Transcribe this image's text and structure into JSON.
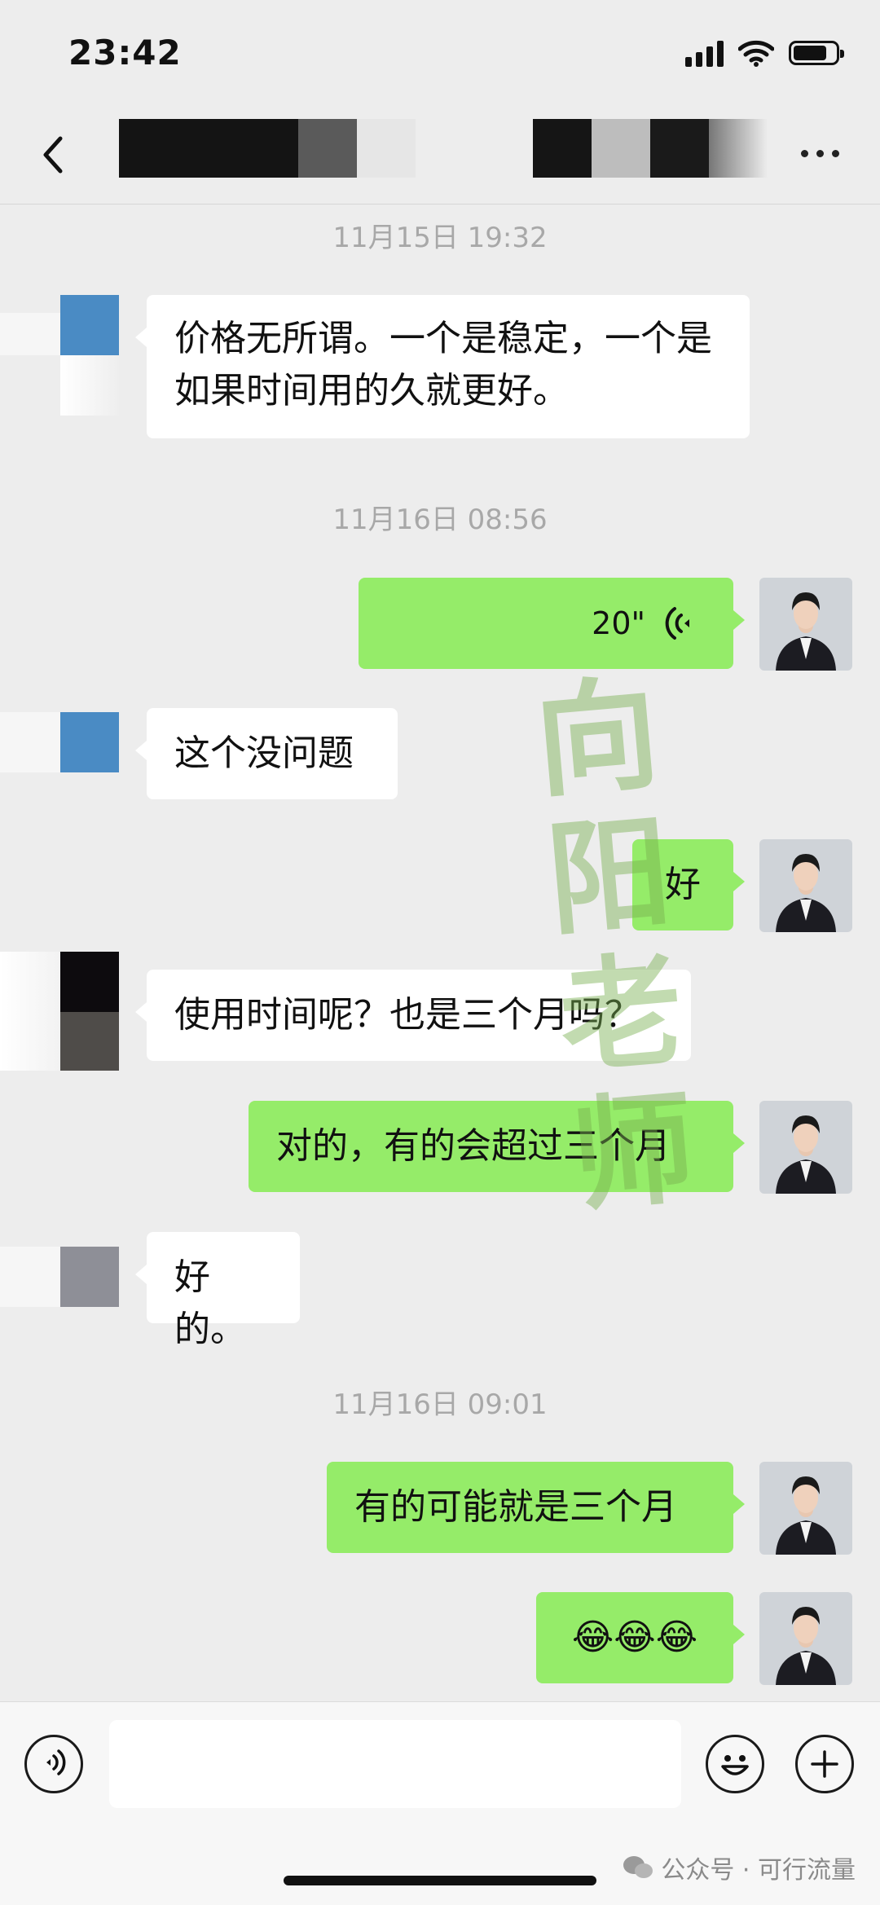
{
  "status_bar": {
    "time": "23:42",
    "battery_level": 0.8,
    "signal_bars": 4
  },
  "nav": {
    "back_icon": "chevron-left-icon",
    "more_icon": "ellipsis-icon"
  },
  "messages": [
    {
      "type": "timestamp",
      "text": "11月15日 19:32"
    },
    {
      "type": "text",
      "side": "in",
      "text": "价格无所谓。一个是稳定，一个是如果时间用的久就更好。"
    },
    {
      "type": "timestamp",
      "text": "11月16日 08:56"
    },
    {
      "type": "voice",
      "side": "out",
      "duration": "20\""
    },
    {
      "type": "text",
      "side": "in",
      "text": "这个没问题"
    },
    {
      "type": "text",
      "side": "out",
      "text": "好"
    },
    {
      "type": "text",
      "side": "in",
      "text": "使用时间呢？也是三个月吗？"
    },
    {
      "type": "text",
      "side": "out",
      "text": "对的，有的会超过三个月"
    },
    {
      "type": "text",
      "side": "in",
      "text": "好的。"
    },
    {
      "type": "timestamp",
      "text": "11月16日 09:01"
    },
    {
      "type": "text",
      "side": "out",
      "text": "有的可能就是三个月"
    },
    {
      "type": "text",
      "side": "out",
      "text": "😂😂😂"
    }
  ],
  "watermark": {
    "text": "向阳老师"
  },
  "input_bar": {
    "voice_icon": "voice-input-icon",
    "emoji_icon": "emoji-icon",
    "plus_icon": "plus-icon",
    "value": ""
  },
  "footer": {
    "text": "公众号 · 可行流量"
  },
  "colors": {
    "outgoing_bubble": "#95ec69",
    "incoming_bubble": "#ffffff",
    "background": "#ededed"
  }
}
